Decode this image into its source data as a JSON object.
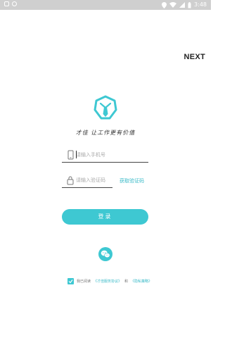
{
  "status_bar": {
    "time": "3:48",
    "icons": [
      "notification-icon",
      "info-icon",
      "location-icon",
      "wifi-icon",
      "signal-icon",
      "battery-icon"
    ]
  },
  "header": {
    "next_label": "NEXT"
  },
  "brand": {
    "logo_icon": "tie-logo-icon",
    "slogan": "才佳 让工作更有价值",
    "accent_color": "#3ec8d2"
  },
  "form": {
    "phone": {
      "icon": "phone-icon",
      "placeholder": "请输入手机号",
      "value": ""
    },
    "code": {
      "icon": "lock-icon",
      "placeholder": "请输入验证码",
      "value": ""
    },
    "get_code_label": "获取验证码",
    "login_label": "登录"
  },
  "social": {
    "wechat_icon": "wechat-icon"
  },
  "agreement": {
    "checked": true,
    "prefix": "我已阅读",
    "link1": "《才佳服务协议》",
    "middle": "和",
    "link2": "《隐私策略》"
  }
}
